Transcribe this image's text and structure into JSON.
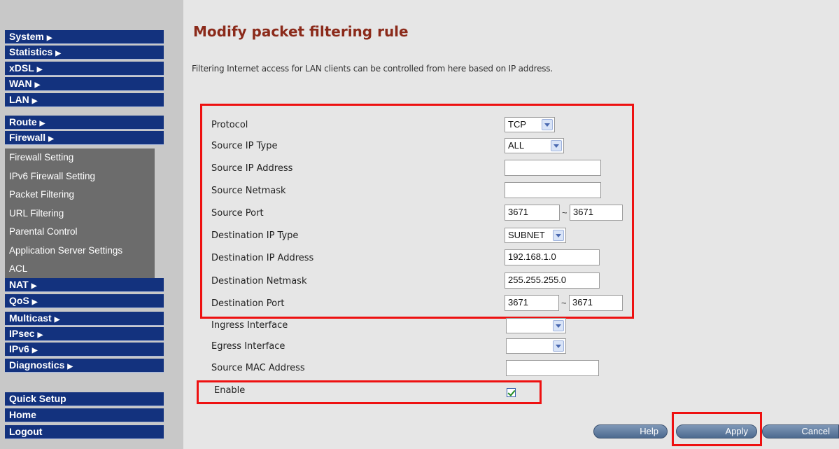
{
  "sidebar": {
    "top_menu": [
      {
        "label": "System"
      },
      {
        "label": "Statistics"
      },
      {
        "label": "xDSL"
      },
      {
        "label": "WAN"
      },
      {
        "label": "LAN"
      },
      {
        "label": "Route"
      },
      {
        "label": "Firewall"
      }
    ],
    "firewall_submenu": [
      {
        "label": "Firewall Setting"
      },
      {
        "label": "IPv6 Firewall Setting"
      },
      {
        "label": "Packet Filtering"
      },
      {
        "label": "URL Filtering"
      },
      {
        "label": "Parental Control"
      },
      {
        "label": "Application Server Settings"
      },
      {
        "label": "ACL"
      }
    ],
    "bottom_menu": [
      {
        "label": "NAT"
      },
      {
        "label": "QoS"
      },
      {
        "label": "Multicast"
      },
      {
        "label": "IPsec"
      },
      {
        "label": "IPv6"
      },
      {
        "label": "Diagnostics"
      }
    ],
    "footer_menu": [
      {
        "label": "Quick Setup"
      },
      {
        "label": "Home"
      },
      {
        "label": "Logout"
      }
    ],
    "arrow": "▶"
  },
  "page": {
    "title": "Modify packet filtering rule",
    "description": "Filtering Internet access for LAN clients can be controlled from here based on IP address."
  },
  "form": {
    "protocol": {
      "label": "Protocol",
      "value": "TCP"
    },
    "source_ip_type": {
      "label": "Source IP Type",
      "value": "ALL"
    },
    "source_ip_address": {
      "label": "Source IP Address",
      "value": ""
    },
    "source_netmask": {
      "label": "Source Netmask",
      "value": ""
    },
    "source_port": {
      "label": "Source Port",
      "from": "3671",
      "to": "3671"
    },
    "destination_ip_type": {
      "label": "Destination IP Type",
      "value": "SUBNET"
    },
    "destination_ip_address": {
      "label": "Destination IP Address",
      "value": "192.168.1.0"
    },
    "destination_netmask": {
      "label": "Destination Netmask",
      "value": "255.255.255.0"
    },
    "destination_port": {
      "label": "Destination Port",
      "from": "3671",
      "to": "3671"
    },
    "ingress_interface": {
      "label": "Ingress Interface",
      "value": ""
    },
    "egress_interface": {
      "label": "Egress Interface",
      "value": ""
    },
    "source_mac_address": {
      "label": "Source MAC Address",
      "value": ""
    },
    "enable": {
      "label": "Enable",
      "checked": true
    },
    "range_separator": "~"
  },
  "buttons": {
    "help": "Help",
    "apply": "Apply",
    "cancel": "Cancel"
  },
  "colors": {
    "menu_bg": "#13327e",
    "submenu_bg": "#6c6c6c",
    "title": "#8b2a1a",
    "highlight": "#ee1111"
  }
}
